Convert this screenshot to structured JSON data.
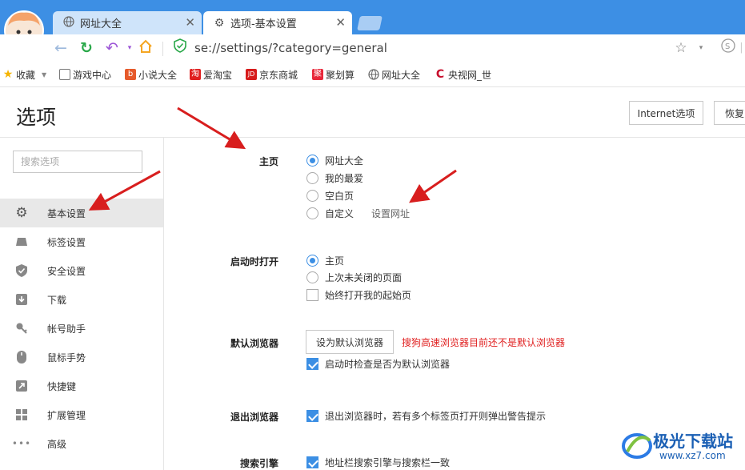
{
  "tabs": [
    {
      "label": "网址大全",
      "icon": "globe-icon"
    },
    {
      "label": "选项-基本设置",
      "icon": "gear-icon",
      "active": true
    }
  ],
  "navbar": {
    "url": "se://settings/?category=general"
  },
  "bookmarks": [
    {
      "label": "收藏",
      "icon": "star-icon"
    },
    {
      "label": "游戏中心",
      "icon": "game-icon"
    },
    {
      "label": "小说大全",
      "icon": "book-icon"
    },
    {
      "label": "爱淘宝",
      "icon": "taobao-icon"
    },
    {
      "label": "京东商城",
      "icon": "jd-icon"
    },
    {
      "label": "聚划算",
      "icon": "juhuasuan-icon"
    },
    {
      "label": "网址大全",
      "icon": "globe-icon"
    },
    {
      "label": "央视网_世",
      "icon": "cctv-icon"
    }
  ],
  "header": {
    "title": "选项",
    "internet_options": "Internet选项",
    "restore": "恢复"
  },
  "sidebar": {
    "search_placeholder": "搜索选项",
    "items": [
      {
        "label": "基本设置",
        "icon": "gear-icon",
        "active": true
      },
      {
        "label": "标签设置",
        "icon": "tab-icon"
      },
      {
        "label": "安全设置",
        "icon": "shield-icon"
      },
      {
        "label": "下载",
        "icon": "download-icon"
      },
      {
        "label": "帐号助手",
        "icon": "key-icon"
      },
      {
        "label": "鼠标手势",
        "icon": "mouse-icon"
      },
      {
        "label": "快捷键",
        "icon": "shortcut-icon"
      },
      {
        "label": "扩展管理",
        "icon": "extension-icon"
      },
      {
        "label": "高级",
        "icon": "more-icon"
      }
    ]
  },
  "homepage": {
    "label": "主页",
    "options": [
      "网址大全",
      "我的最爱",
      "空白页",
      "自定义"
    ],
    "selected": "网址大全",
    "set_url": "设置网址"
  },
  "startup": {
    "label": "启动时打开",
    "options": [
      "主页",
      "上次未关闭的页面"
    ],
    "selected": "主页",
    "always_open": "始终打开我的起始页"
  },
  "default_browser": {
    "label": "默认浏览器",
    "button": "设为默认浏览器",
    "warning": "搜狗高速浏览器目前还不是默认浏览器",
    "check_on_start": "启动时检查是否为默认浏览器"
  },
  "exit_browser": {
    "label": "退出浏览器",
    "warn_multiple_tabs": "退出浏览器时，若有多个标签页打开则弹出警告提示"
  },
  "search_engine": {
    "label": "搜索引擎",
    "sync": "地址栏搜索引擎与搜索栏一致"
  },
  "watermark": {
    "text": "极光下载站",
    "url": "www.xz7.com"
  },
  "colors": {
    "accent": "#3c8fe4",
    "tabstrip": "#3d8fe4",
    "warning": "#e02020",
    "annotation_arrow": "#d81e1e"
  }
}
